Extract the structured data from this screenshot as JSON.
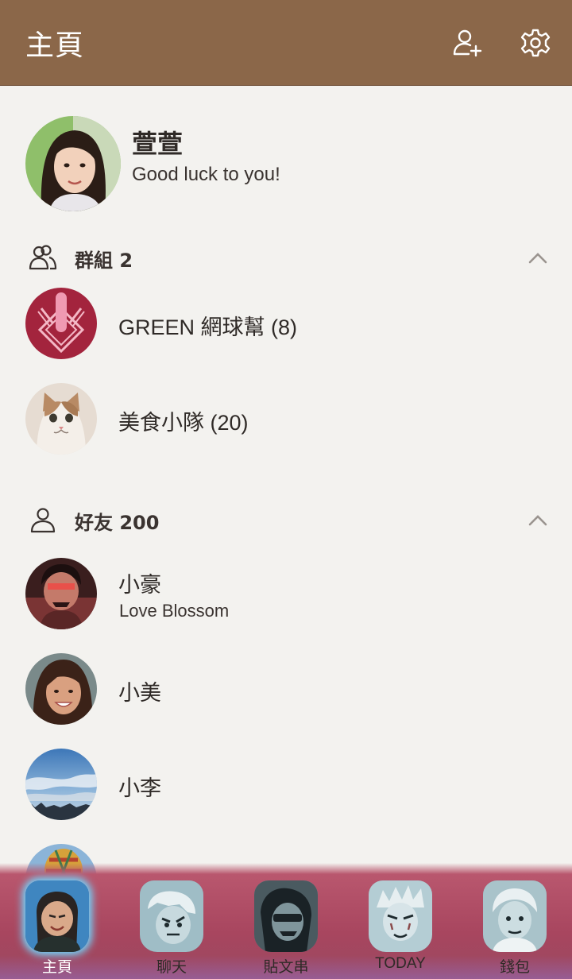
{
  "header": {
    "title": "主頁",
    "icons": [
      "add-friend-icon",
      "settings-gear-icon"
    ],
    "background": "#8b6749"
  },
  "profile": {
    "name": "萱萱",
    "status": "Good luck to you!"
  },
  "groups": {
    "title": "群組 2",
    "items": [
      {
        "name": "GREEN 網球幫 (8)",
        "avatar": "crest-avatar"
      },
      {
        "name": "美食小隊 (20)",
        "avatar": "cat-avatar"
      }
    ]
  },
  "friends": {
    "title": "好友 200",
    "items": [
      {
        "name": "小豪",
        "status": "Love Blossom",
        "avatar": "anime-character-avatar"
      },
      {
        "name": "小美",
        "status": "",
        "avatar": "woman-avatar"
      },
      {
        "name": "小李",
        "status": "",
        "avatar": "sky-avatar"
      },
      {
        "name": "",
        "status": "",
        "avatar": "balloon-avatar"
      }
    ]
  },
  "tabbar": {
    "tabs": [
      {
        "label": "主頁",
        "active": true
      },
      {
        "label": "聊天",
        "active": false
      },
      {
        "label": "貼文串",
        "active": false
      },
      {
        "label": "TODAY",
        "active": false
      },
      {
        "label": "錢包",
        "active": false
      }
    ]
  }
}
